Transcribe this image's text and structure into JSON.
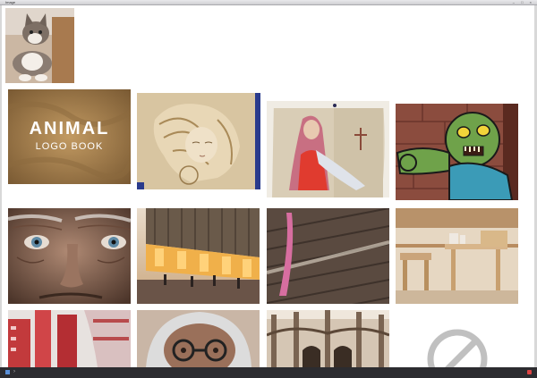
{
  "window": {
    "title": "Image",
    "controls": "– □ ×"
  },
  "thumbnails": {
    "logo_title": "ANIMAL",
    "logo_subtitle": "LOGO BOOK"
  }
}
